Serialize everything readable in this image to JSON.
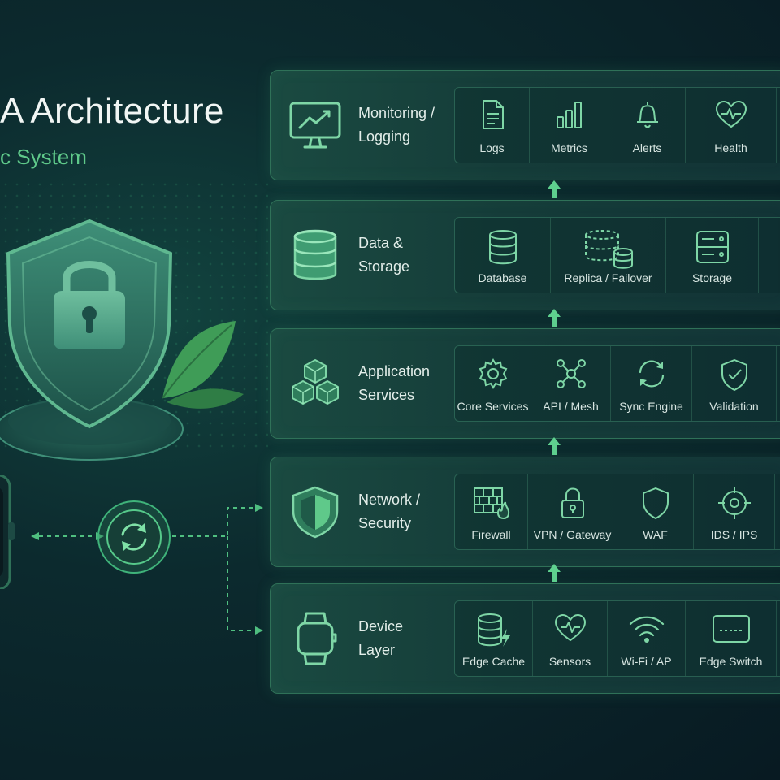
{
  "header": {
    "title": "A Architecture",
    "subtitle": "c System"
  },
  "colors": {
    "accent": "#5fc98a",
    "panel_border": "#2f7158",
    "background": "#0a1f26"
  },
  "layers": [
    {
      "label": "Monitoring /\nLogging",
      "icon": "monitor-chart-icon",
      "items": [
        {
          "label": "Logs",
          "icon": "document-icon"
        },
        {
          "label": "Metrics",
          "icon": "bar-chart-icon"
        },
        {
          "label": "Alerts",
          "icon": "bell-icon"
        },
        {
          "label": "Health",
          "icon": "heartbeat-icon"
        }
      ]
    },
    {
      "label": "Data &\nStorage",
      "icon": "database-icon",
      "items": [
        {
          "label": "Database",
          "icon": "database-icon"
        },
        {
          "label": "Replica / Failover",
          "icon": "replica-icon"
        },
        {
          "label": "Storage",
          "icon": "server-icon"
        }
      ]
    },
    {
      "label": "Application\nServices",
      "icon": "cubes-icon",
      "items": [
        {
          "label": "Core Services",
          "icon": "gear-icon"
        },
        {
          "label": "API / Mesh",
          "icon": "mesh-icon"
        },
        {
          "label": "Sync Engine",
          "icon": "sync-icon"
        },
        {
          "label": "Validation",
          "icon": "shield-check-icon"
        }
      ]
    },
    {
      "label": "Network /\nSecurity",
      "icon": "shield-icon",
      "items": [
        {
          "label": "Firewall",
          "icon": "firewall-icon"
        },
        {
          "label": "VPN / Gateway",
          "icon": "lock-icon"
        },
        {
          "label": "WAF",
          "icon": "shield-outline-icon"
        },
        {
          "label": "IDS / IPS",
          "icon": "crosshair-icon"
        }
      ]
    },
    {
      "label": "Device\nLayer",
      "icon": "smartwatch-icon",
      "items": [
        {
          "label": "Edge Cache",
          "icon": "database-bolt-icon"
        },
        {
          "label": "Sensors",
          "icon": "heart-pulse-icon"
        },
        {
          "label": "Wi-Fi / AP",
          "icon": "wifi-icon"
        },
        {
          "label": "Edge Switch",
          "icon": "switch-icon"
        }
      ]
    }
  ]
}
